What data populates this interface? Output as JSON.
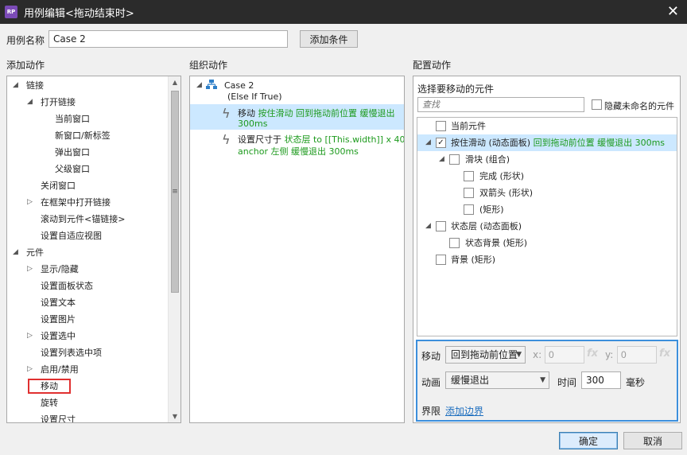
{
  "title": {
    "app_icon": "RP",
    "text": "用例编辑<拖动结束时>",
    "close": "✕"
  },
  "case_name": {
    "label": "用例名称",
    "value": "Case 2",
    "add_condition": "添加条件"
  },
  "headers": {
    "add_action": "添加动作",
    "organize_action": "组织动作",
    "configure_action": "配置动作"
  },
  "add_action_tree": [
    {
      "label": "链接",
      "expanded": true
    },
    {
      "label": "打开链接",
      "expanded": true
    },
    {
      "label": "当前窗口"
    },
    {
      "label": "新窗口/新标签"
    },
    {
      "label": "弹出窗口"
    },
    {
      "label": "父级窗口"
    },
    {
      "label": "关闭窗口"
    },
    {
      "label": "在框架中打开链接",
      "expanded": false
    },
    {
      "label": "滚动到元件<锚链接>"
    },
    {
      "label": "设置自适应视图"
    },
    {
      "label": "元件",
      "expanded": true
    },
    {
      "label": "显示/隐藏",
      "expanded": false
    },
    {
      "label": "设置面板状态"
    },
    {
      "label": "设置文本"
    },
    {
      "label": "设置图片"
    },
    {
      "label": "设置选中",
      "expanded": false
    },
    {
      "label": "设置列表选中项"
    },
    {
      "label": "启用/禁用",
      "expanded": false
    },
    {
      "label": "移动",
      "highlight": "#e03030"
    },
    {
      "label": "旋转"
    },
    {
      "label": "设置尺寸"
    }
  ],
  "organize": {
    "case_title": "Case 2",
    "case_sub": "(Else If True)",
    "actions": [
      {
        "verb": "移动",
        "detail_1": "按住滑动 回到拖动前位置 缓慢退出",
        "detail_2": "300ms",
        "selected": true
      },
      {
        "verb": "设置尺寸于",
        "detail_1": "状态层 to [[This.width]] x 40",
        "detail_2": "anchor 左侧 缓慢退出 300ms",
        "selected": false
      }
    ]
  },
  "configure": {
    "select_label": "选择要移动的元件",
    "search_placeholder": "查找",
    "hide_unnamed": "隐藏未命名的元件",
    "widgets": [
      {
        "name": "当前元件",
        "extra": "",
        "checked": false
      },
      {
        "name": "按住滑动 (动态面板)",
        "extra": "回到拖动前位置 缓慢退出 300ms",
        "checked": true,
        "selected": true
      },
      {
        "name": "滑块 (组合)",
        "extra": "",
        "checked": false
      },
      {
        "name": "完成 (形状)",
        "extra": "",
        "checked": false
      },
      {
        "name": "双箭头 (形状)",
        "extra": "",
        "checked": false
      },
      {
        "name": "(矩形)",
        "extra": "",
        "checked": false
      },
      {
        "name": "状态层 (动态面板)",
        "extra": "",
        "checked": false
      },
      {
        "name": "状态背景 (矩形)",
        "extra": "",
        "checked": false
      },
      {
        "name": "背景 (矩形)",
        "extra": "",
        "checked": false
      }
    ],
    "move_label": "移动",
    "move_value": "回到拖动前位置",
    "x_label": "x:",
    "x_value": "0",
    "y_label": "y:",
    "y_value": "0",
    "fx": "fx",
    "anim_label": "动画",
    "anim_value": "缓慢退出",
    "time_label": "时间",
    "time_value": "300",
    "ms_label": "毫秒",
    "bound_label": "界限",
    "add_bound": "添加边界",
    "border_color": "#3c8fdc"
  },
  "footer": {
    "ok": "确定",
    "cancel": "取消"
  }
}
